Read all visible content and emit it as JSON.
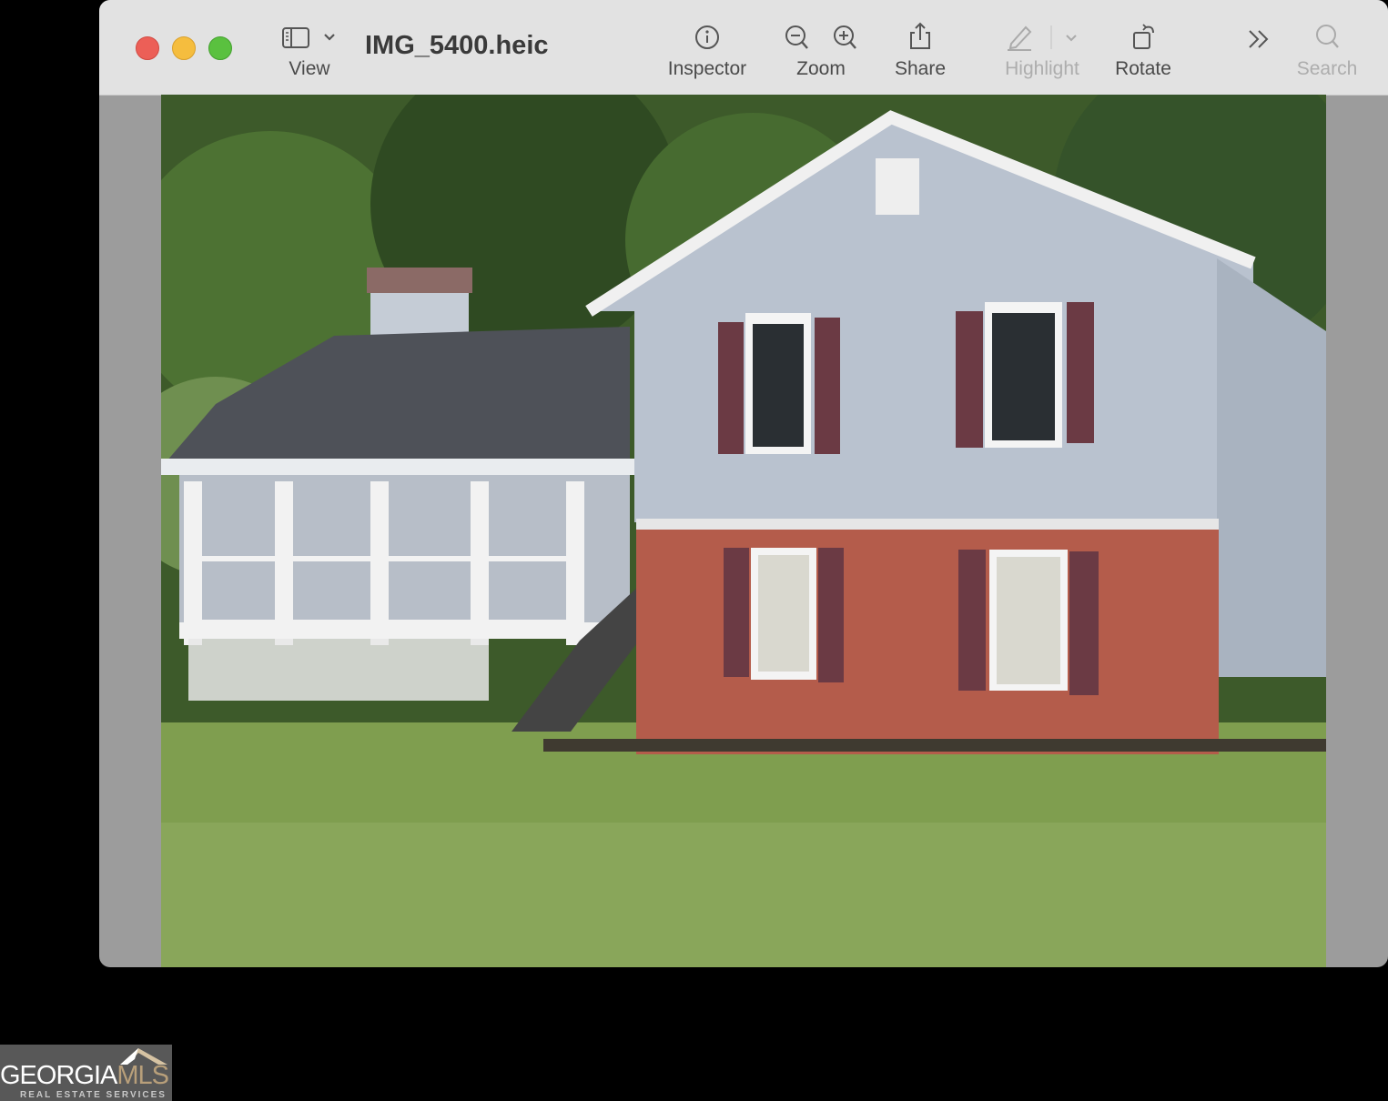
{
  "window": {
    "title": "IMG_5400.heic",
    "traffic_lights": {
      "close": "#ec5f57",
      "minimize": "#f5bd3e",
      "zoom": "#5ac13f"
    }
  },
  "toolbar": {
    "view_label": "View",
    "inspector_label": "Inspector",
    "zoom_label": "Zoom",
    "share_label": "Share",
    "highlight_label": "Highlight",
    "rotate_label": "Rotate",
    "search_label": "Search",
    "icons": [
      "sidebar-icon",
      "chevron-down-icon",
      "info-icon",
      "zoom-out-icon",
      "zoom-in-icon",
      "share-icon",
      "pencil-icon",
      "rotate-icon",
      "more-chevrons-icon",
      "search-icon"
    ]
  },
  "image": {
    "subject": "house photo"
  },
  "watermark": {
    "brand": "GEORGIA",
    "brand_accent": "MLS",
    "tagline": "REAL ESTATE SERVICES"
  }
}
